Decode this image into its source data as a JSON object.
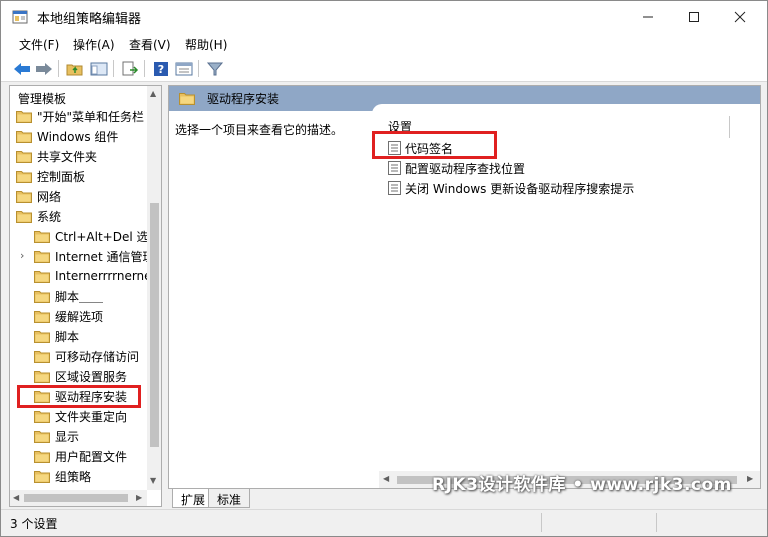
{
  "window": {
    "title": "本地组策略编辑器"
  },
  "menu": {
    "items": [
      {
        "label": "文件(F)"
      },
      {
        "label": "操作(A)"
      },
      {
        "label": "查看(V)"
      },
      {
        "label": "帮助(H)"
      }
    ]
  },
  "toolbar": {
    "buttons": [
      "back-icon",
      "forward-icon",
      "up-folder-icon",
      "show-hide-tree-icon",
      "export-list-icon",
      "help-icon",
      "properties-view-icon",
      "filter-icon"
    ]
  },
  "tree": {
    "root": "管理模板",
    "items": [
      {
        "label": "\"开始\"菜单和任务栏",
        "level": 1
      },
      {
        "label": "Windows 组件",
        "level": 1
      },
      {
        "label": "共享文件夹",
        "level": 1
      },
      {
        "label": "控制面板",
        "level": 1
      },
      {
        "label": "网络",
        "level": 1
      },
      {
        "label": "系统",
        "level": 1
      },
      {
        "label": "Ctrl+Alt+Del 选项",
        "level": 2
      },
      {
        "label": "Internet 通信管理",
        "level": 2,
        "expandable": true
      },
      {
        "label": "Internerrrrnerne",
        "level": 2
      },
      {
        "label": "脚本＿＿",
        "level": 2
      },
      {
        "label": "缓解选项",
        "level": 2
      },
      {
        "label": "脚本",
        "level": 2
      },
      {
        "label": "可移动存储访问",
        "level": 2
      },
      {
        "label": "区域设置服务",
        "level": 2
      },
      {
        "label": "驱动程序安装",
        "level": 2,
        "selected": true
      },
      {
        "label": "文件夹重定向",
        "level": 2
      },
      {
        "label": "显示",
        "level": 2
      },
      {
        "label": "用户配置文件",
        "level": 2
      },
      {
        "label": "组策略",
        "level": 2
      }
    ]
  },
  "right_pane": {
    "header": "驱动程序安装",
    "description": "选择一个项目来查看它的描述。",
    "column_header": "设置",
    "policies": [
      {
        "label": "代码签名",
        "highlighted": true
      },
      {
        "label": "配置驱动程序查找位置"
      },
      {
        "label": "关闭 Windows 更新设备驱动程序搜索提示"
      }
    ]
  },
  "tabs": [
    {
      "label": "扩展",
      "active": true
    },
    {
      "label": "标准",
      "active": false
    }
  ],
  "status": {
    "text": "3 个设置"
  },
  "watermark": {
    "text": "RJK3设计软件库 • www.rjk3.com"
  },
  "colors": {
    "header_bar": "#8fa7c6",
    "highlight": "#e02020",
    "folder": "#e8c060"
  }
}
